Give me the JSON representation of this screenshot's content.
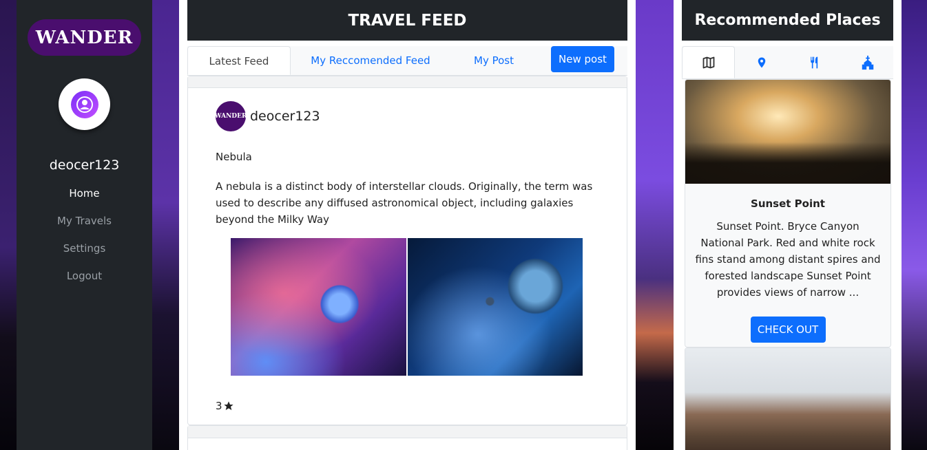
{
  "sidebar": {
    "logo_text": "WANDER",
    "username": "deocer123",
    "nav": [
      {
        "label": "Home",
        "active": true
      },
      {
        "label": "My Travels",
        "active": false
      },
      {
        "label": "Settings",
        "active": false
      },
      {
        "label": "Logout",
        "active": false
      }
    ]
  },
  "feed": {
    "title": "TRAVEL FEED",
    "tabs": [
      "Latest Feed",
      "My Reccomended Feed",
      "My Post"
    ],
    "new_post_label": "New post",
    "post": {
      "author_logo": "WANDER",
      "author": "deocer123",
      "title": "Nebula",
      "body": "A nebula is a distinct body of interstellar clouds. Originally, the term was used to describe any diffused astronomical object, including galaxies beyond the Milky Way",
      "rating": "3",
      "rating_icon": "star-icon"
    }
  },
  "recommended": {
    "title": "Recommended Places",
    "tab_icons": [
      "map-icon",
      "location-pin-icon",
      "restaurant-icon",
      "church-icon"
    ],
    "places": [
      {
        "name": "Sunset Point",
        "description": "Sunset Point. Bryce Canyon National Park. Red and white rock fins stand among distant spires and forested landscape Sunset Point provides views of narrow ...",
        "button": "CHECK OUT"
      }
    ]
  },
  "colors": {
    "primary": "#0d6efd",
    "dark": "#212529",
    "brand": "#4a0e6e"
  }
}
